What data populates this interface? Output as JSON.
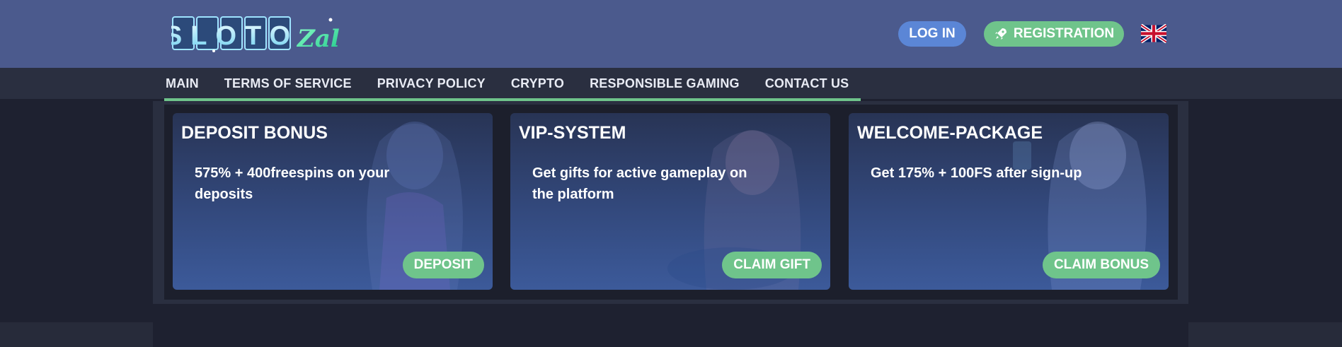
{
  "header": {
    "logo_text_main": "SLOTO",
    "logo_text_accent": "Zal",
    "login_label": "LOG IN",
    "registration_label": "REGISTRATION",
    "language": "English"
  },
  "nav": {
    "items": [
      {
        "label": "MAIN"
      },
      {
        "label": "TERMS OF SERVICE"
      },
      {
        "label": "PRIVACY POLICY"
      },
      {
        "label": "CRYPTO"
      },
      {
        "label": "RESPONSIBLE GAMING"
      },
      {
        "label": "CONTACT US"
      }
    ]
  },
  "cards": [
    {
      "title": "DEPOSIT BONUS",
      "description": "575% + 400freespins on your deposits",
      "button": "DEPOSIT"
    },
    {
      "title": "VIP-SYSTEM",
      "description": "Get gifts for active gameplay on the platform",
      "button": "CLAIM GIFT"
    },
    {
      "title": "WELCOME-PACKAGE",
      "description": "Get 175% + 100FS after sign-up",
      "button": "CLAIM BONUS"
    }
  ],
  "colors": {
    "header_bg": "#4b5a8d",
    "nav_bg": "#2a2f40",
    "accent_green": "#6fc48b",
    "login_blue": "#5b86d6",
    "page_bg": "#1e2130"
  },
  "icons": {
    "registration": "rocket-icon",
    "language": "uk-flag-icon"
  }
}
